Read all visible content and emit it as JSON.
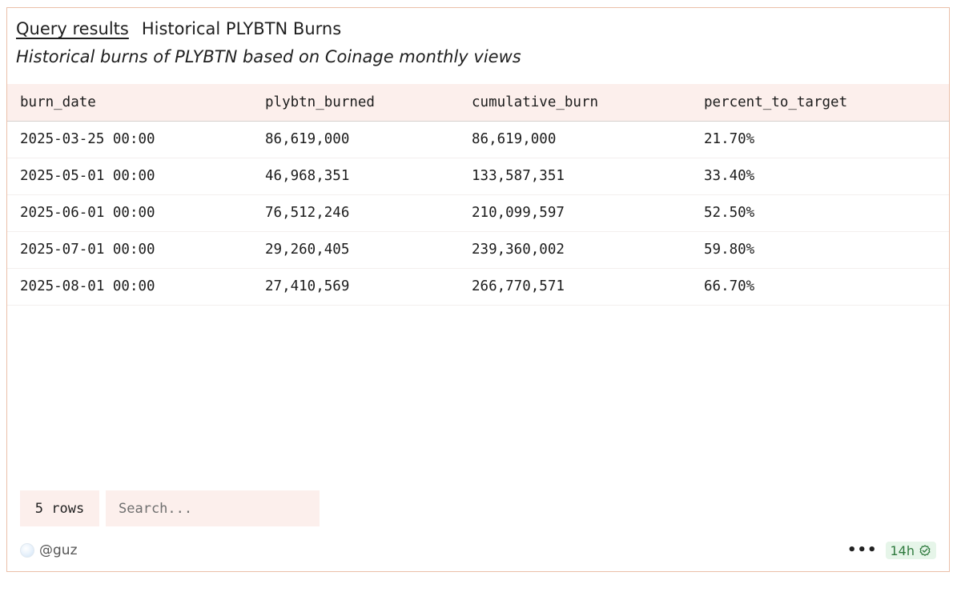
{
  "header": {
    "link_label": "Query results",
    "query_name": "Historical PLYBTN Burns",
    "description": "Historical burns of PLYBTN based on Coinage monthly views"
  },
  "table": {
    "columns": [
      "burn_date",
      "plybtn_burned",
      "cumulative_burn",
      "percent_to_target"
    ],
    "rows": [
      [
        "2025-03-25 00:00",
        "86,619,000",
        "86,619,000",
        "21.70%"
      ],
      [
        "2025-05-01 00:00",
        "46,968,351",
        "133,587,351",
        "33.40%"
      ],
      [
        "2025-06-01 00:00",
        "76,512,246",
        "210,099,597",
        "52.50%"
      ],
      [
        "2025-07-01 00:00",
        "29,260,405",
        "239,360,002",
        "59.80%"
      ],
      [
        "2025-08-01 00:00",
        "27,410,569",
        "266,770,571",
        "66.70%"
      ]
    ]
  },
  "footer": {
    "rows_count": "5 rows",
    "search_placeholder": "Search..."
  },
  "meta": {
    "user": "@guz",
    "more_icon": "ellipsis-icon",
    "age": "14h",
    "age_icon": "check-circle-icon"
  },
  "colors": {
    "accent_border": "#ebbfa9",
    "header_bg": "#fcefec",
    "badge_bg": "#e6f5e9",
    "badge_text": "#2f7a3e"
  }
}
